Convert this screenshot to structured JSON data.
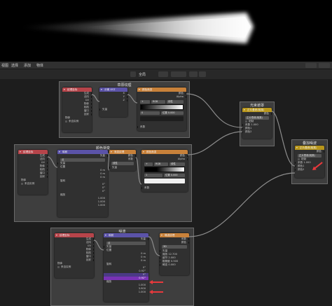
{
  "header": {
    "menus": [
      "视图",
      "选择",
      "添加",
      "物体"
    ],
    "mode_label": "全局"
  },
  "frames": {
    "top": "草原纹理",
    "middle": "颜色渐变",
    "bottom": "噪波"
  },
  "tex_coord": {
    "title": "纹理坐标",
    "outputs": [
      "生成",
      "法向",
      "UV",
      "物体",
      "相机",
      "窗口",
      "反射"
    ],
    "object_label": "物体",
    "from_instancer": "来自实例"
  },
  "mapping": {
    "title": "映射",
    "output": "矢量",
    "type_value": "点",
    "input_vector": "矢量",
    "location": "位置",
    "rotation": "旋转",
    "scale": "缩放",
    "loc_values": [
      "0 m",
      "0 m",
      "0 m"
    ],
    "rot_values": [
      "0°",
      "0°",
      "0°"
    ],
    "scale_values": [
      "1.000",
      "1.000",
      "1.000"
    ]
  },
  "sep_xyz": {
    "title": "分离 XYZ",
    "outputs": [
      "X",
      "Y",
      "Z"
    ],
    "input": "矢量"
  },
  "ramp_top": {
    "title": "颜色渐变",
    "outputs": [
      "颜色",
      "Alpha"
    ],
    "mode": "RGB",
    "interp": "线性",
    "pos_label": "位置",
    "pos_value": "0.000",
    "input": "系数"
  },
  "ramp_mid": {
    "title": "颜色渐变",
    "outputs": [
      "颜色",
      "Alpha"
    ],
    "mode": "RGB",
    "interp": "线性",
    "pos_label": "位置",
    "pos_value": "0.000",
    "input": "系数"
  },
  "gradient": {
    "title": "渐变纹理",
    "outputs": [
      "颜色",
      "系数"
    ],
    "type_value": "线性",
    "input": "矢量"
  },
  "noise": {
    "title": "噪波纹理",
    "outputs": [
      "系数",
      "颜色"
    ],
    "dim": "3D",
    "input_vector": "矢量",
    "rows": [
      {
        "label": "缩放",
        "value": "12.700"
      },
      {
        "label": "细节",
        "value": "2.000"
      },
      {
        "label": "粗糙度",
        "value": "0.500"
      },
      {
        "label": "畸变",
        "value": "0.000"
      }
    ]
  },
  "mix_shader": {
    "title": "正片叠底(相乘)",
    "subtitle": "正片叠底(相乘)",
    "outputs": [
      "颜色"
    ],
    "clamp": "钳制",
    "inputs": [
      "系数",
      "颜色1",
      "颜色2"
    ],
    "fac_value": "1.000"
  },
  "frame_mix": {
    "title": "光束遮罩",
    "mix_title": "正片叠底(相乘)",
    "output": "颜色",
    "mode_value": "正片叠底(相乘)",
    "clamp": "钳制",
    "inputs": [
      "系数",
      "颜色1",
      "颜色2"
    ],
    "fac_value": "1.000"
  },
  "frame_add": {
    "title": "叠加噪波",
    "mix_title": "正片叠底(相乘)",
    "output": "颜色",
    "mode_value": "正片叠底(相乘)",
    "clamp": "钳制",
    "inputs": [
      "系数",
      "颜色1",
      "颜色2"
    ],
    "fac_value": "1.000"
  },
  "noise_mapping": {
    "title": "映射",
    "output": "矢量",
    "type_value": "点",
    "input_vector": "矢量",
    "location": "位置",
    "rotation": "旋转",
    "scale": "缩放",
    "loc_values": [
      "0 m",
      "0 m",
      "0 m"
    ],
    "rot_values": [
      "0°",
      "0.92°",
      "0°"
    ],
    "scale_values": [
      "1.000",
      "3.900",
      "1.000"
    ]
  },
  "colors": {
    "accent_purple": "#7a32b5",
    "arrow_red": "#e8393c",
    "frame_bg": "#3e3e3e"
  }
}
